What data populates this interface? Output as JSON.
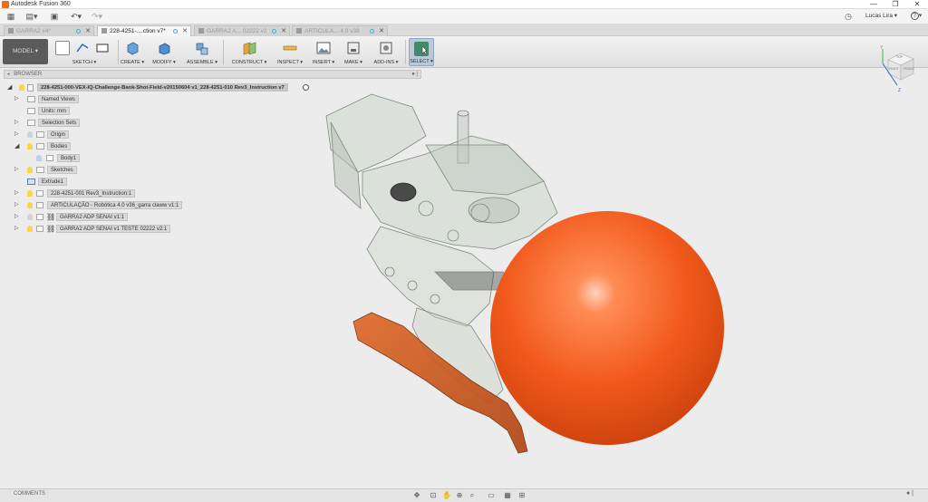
{
  "app": {
    "title": "Autodesk Fusion 360"
  },
  "window": {
    "minimize": "—",
    "restore": "❐",
    "close": "✕"
  },
  "quickaccess": {
    "user": "Lucas Lira",
    "help": "?"
  },
  "tabs": [
    {
      "label": "GARRA2 v4*",
      "active": false
    },
    {
      "label": "228-4251-....ction v7*",
      "active": true
    },
    {
      "label": "GARRA2 A... 02222 v2",
      "active": false
    },
    {
      "label": "ARTICULA... 4.0 v38",
      "active": false
    }
  ],
  "toolbar": {
    "workspace": "MODEL",
    "groups": [
      "SKETCH ▾",
      "CREATE ▾",
      "MODIFY ▾",
      "ASSEMBLE ▾",
      "CONSTRUCT ▾",
      "INSPECT ▾",
      "INSERT ▾",
      "MAKE ▾",
      "ADD-INS ▾",
      "SELECT ▾"
    ]
  },
  "browser": {
    "header": "BROWSER",
    "root": "228-4251-000-VEX-IQ-Challenge-Bank-Shot-Field-v20150604 v1_228-4251-010 Rev3_Instruction v7",
    "items": [
      "Named Views",
      "Units: mm",
      "Selection Sets",
      "Origin",
      "Bodies",
      "Body1",
      "Sketches",
      "Extrude1",
      "228-4251-001 Rev3_Instruction:1",
      "ARTICULAÇÃO - Robótica 4.0 v36_garra claww v1:1",
      "GARRA2 ADP SENAI v1:1",
      "GARRA2 ADP SENAI v1 TESTE 02222 v2:1"
    ]
  },
  "viewcube": {
    "top": "TOP",
    "front": "FRONT",
    "right": "RIGHT"
  },
  "statusbar": {
    "comments": "COMMENTS"
  },
  "colors": {
    "ball": "#f25a1c",
    "accent": "#e8701a"
  }
}
